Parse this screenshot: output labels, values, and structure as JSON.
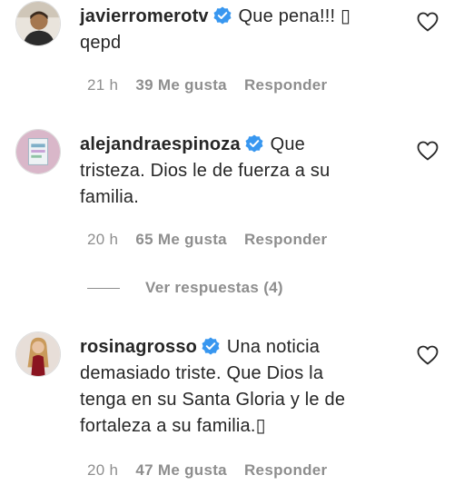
{
  "colors": {
    "verified": "#3897f0",
    "muted": "#8e8e8e",
    "text": "#262626"
  },
  "comments": [
    {
      "username": "javierromerotv",
      "text_line1": "Que pena!!! ▯",
      "text_line2": "qepd",
      "time": "21 h",
      "likes": "39 Me gusta",
      "reply": "Responder"
    },
    {
      "username": "alejandraespinoza",
      "text_line1": "Que",
      "text_line2": "tristeza. Dios le de fuerza a su",
      "text_line3": "familia.",
      "time": "20 h",
      "likes": "65 Me gusta",
      "reply": "Responder",
      "view_replies": "Ver respuestas (4)"
    },
    {
      "username": "rosinagrosso",
      "text_line1": "Una noticia",
      "text_line2": "demasiado triste. Que Dios la",
      "text_line3": "tenga en su Santa Gloria y le de",
      "text_line4": "fortaleza a su familia.▯",
      "time": "20 h",
      "likes": "47 Me gusta",
      "reply": "Responder"
    }
  ]
}
